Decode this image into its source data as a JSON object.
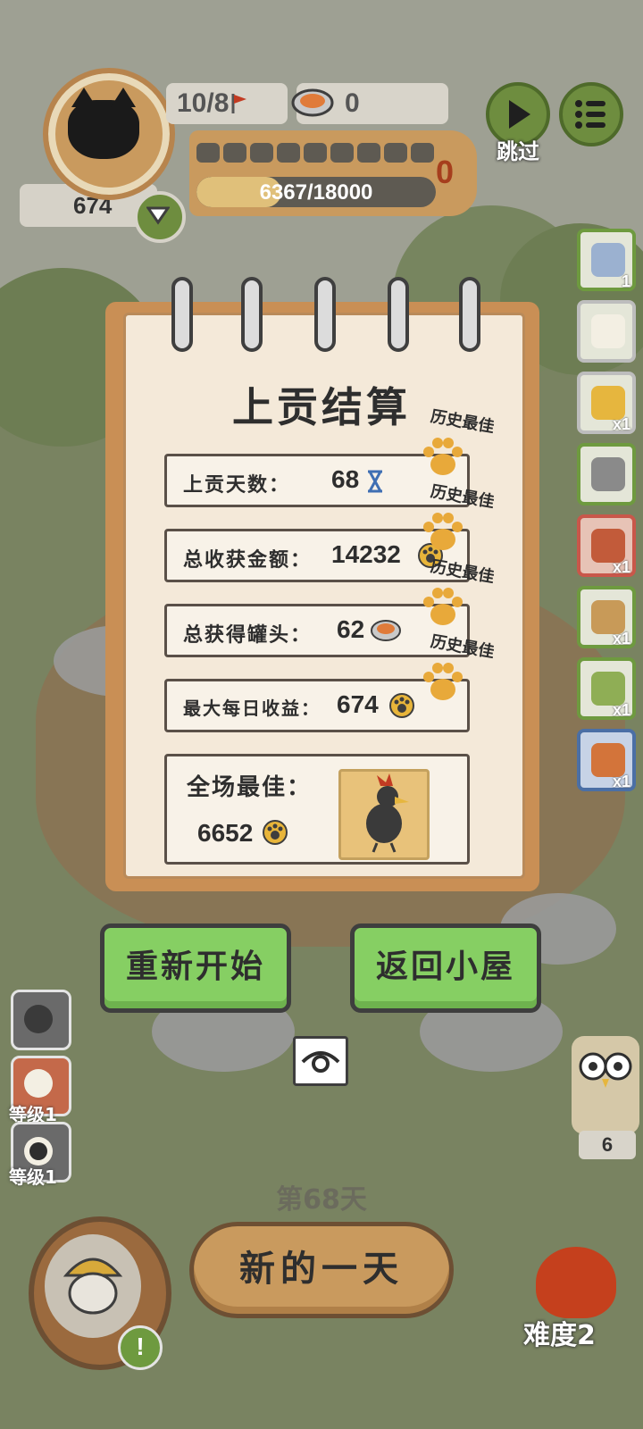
{
  "hud": {
    "coins": "674",
    "stage": "10/8",
    "cans": "0",
    "xp_text": "6367/18000",
    "xp_progress": 0.354,
    "level_segments": 9,
    "side_zero": "0",
    "skip_label": "跳过"
  },
  "side_items": [
    {
      "icon": "hourglass-item-icon",
      "count": "1"
    },
    {
      "icon": "feather-item-icon",
      "count": ""
    },
    {
      "icon": "crown-item-icon",
      "count": "x1"
    },
    {
      "icon": "shorts-item-icon",
      "count": ""
    },
    {
      "icon": "cage-item-icon",
      "count": "x1"
    },
    {
      "icon": "bag-item-icon",
      "count": "x1"
    },
    {
      "icon": "helmet-item-icon",
      "count": "x1"
    },
    {
      "icon": "glove-item-icon",
      "count": "x1"
    }
  ],
  "dialog": {
    "title": "上贡结算",
    "best_tag": "历史最佳",
    "rows": [
      {
        "label": "上贡天数：",
        "value": "68",
        "icon": "hourglass-icon"
      },
      {
        "label": "总收获金额：",
        "value": "14232",
        "icon": "paw-coin-icon"
      },
      {
        "label": "总获得罐头：",
        "value": "62",
        "icon": "can-icon"
      },
      {
        "label": "最大每日收益：",
        "value": "674",
        "icon": "paw-coin-icon"
      }
    ],
    "all_best_label": "全场最佳：",
    "all_best_value": "6652"
  },
  "buttons": {
    "restart": "重新开始",
    "back_home": "返回小屋",
    "new_day": "新的一天"
  },
  "left_slots": [
    {
      "level": ""
    },
    {
      "level": "等级1"
    },
    {
      "level": "等级1"
    }
  ],
  "day_label": "第68天",
  "difficulty": "难度2",
  "owl_count": "6",
  "colors": {
    "accent_green": "#86cf63",
    "wood": "#c99a5e",
    "paper": "#f4e9d9",
    "paw": "#e8a93a"
  }
}
